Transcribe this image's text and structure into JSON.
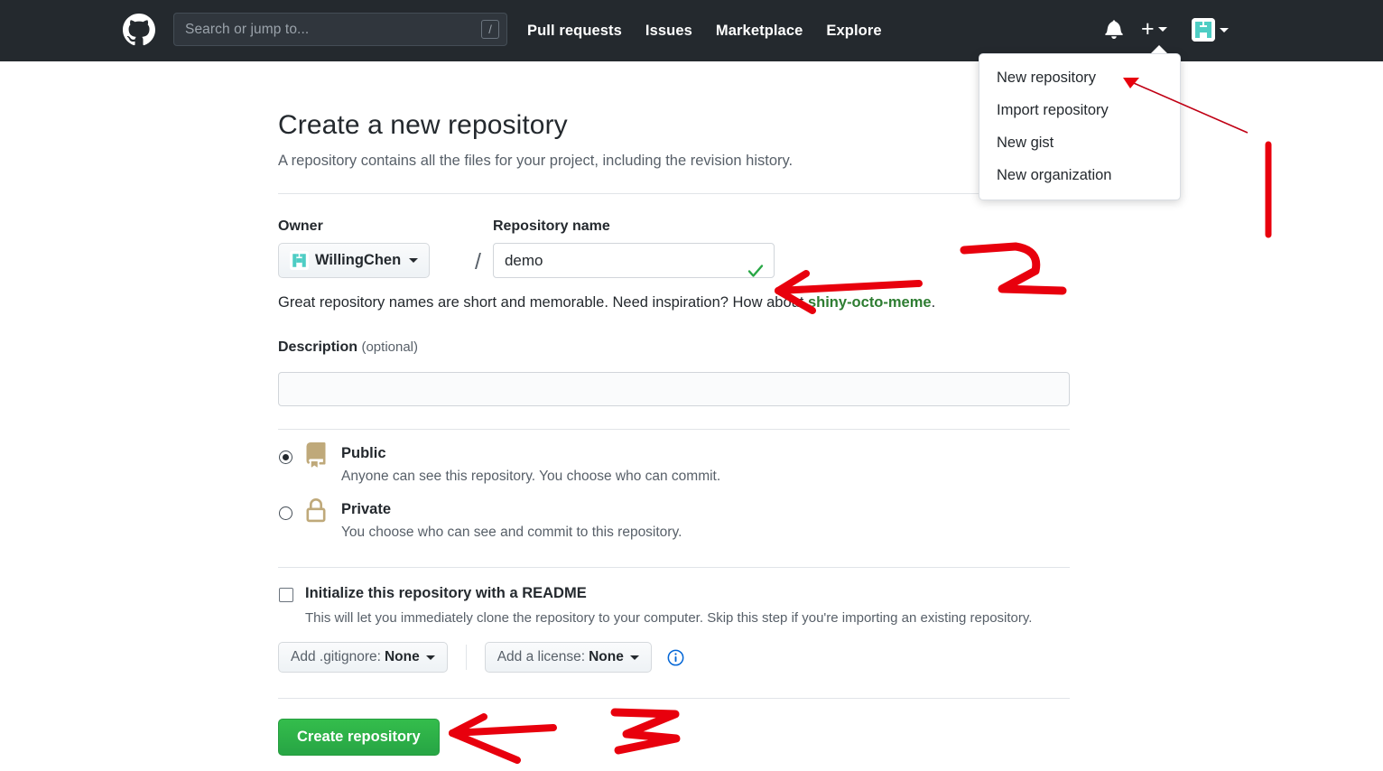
{
  "header": {
    "logo_icon": "github-mark-icon",
    "search": {
      "placeholder": "Search or jump to...",
      "value": "",
      "shortcut_key": "/"
    },
    "nav": [
      {
        "label": "Pull requests"
      },
      {
        "label": "Issues"
      },
      {
        "label": "Marketplace"
      },
      {
        "label": "Explore"
      }
    ],
    "notifications_icon": "bell-icon",
    "create_new_icon": "plus-icon",
    "account_icon": "avatar-icon",
    "background_color": "#24292e"
  },
  "create_menu": {
    "items": [
      {
        "label": "New repository"
      },
      {
        "label": "Import repository"
      },
      {
        "label": "New gist"
      },
      {
        "label": "New organization"
      }
    ]
  },
  "main": {
    "title": "Create a new repository",
    "subtitle": "A repository contains all the files for your project, including the revision history.",
    "owner": {
      "label": "Owner",
      "value": "WillingChen",
      "separator": "/"
    },
    "repository_name": {
      "label": "Repository name",
      "value": "demo",
      "placeholder": "",
      "valid_icon": "check-icon",
      "valid_color": "#28a745"
    },
    "name_hint": {
      "before": "Great repository names are short and memorable. Need inspiration? How about ",
      "link": "shiny-octo-meme",
      "after": ".",
      "link_color": "#2e7d32"
    },
    "description": {
      "label": "Description",
      "optional_label": "(optional)",
      "value": "",
      "placeholder": ""
    },
    "visibility": [
      {
        "id": "public",
        "icon": "repo-book-icon",
        "title": "Public",
        "description": "Anyone can see this repository. You choose who can commit.",
        "selected": true
      },
      {
        "id": "private",
        "icon": "lock-icon",
        "title": "Private",
        "description": "You choose who can see and commit to this repository.",
        "selected": false
      }
    ],
    "readme": {
      "title": "Initialize this repository with a README",
      "description": "This will let you immediately clone the repository to your computer. Skip this step if you're importing an existing repository.",
      "checked": false
    },
    "gitignore": {
      "prefix": "Add .gitignore:",
      "value": "None"
    },
    "license": {
      "prefix": "Add a license:",
      "value": "None"
    },
    "info_icon": "info-icon",
    "submit": {
      "label": "Create repository",
      "color": "#28a745"
    }
  },
  "annotations": {
    "color": "#e8000d",
    "marks": [
      {
        "name": "pointer-arrow-to-new-repository",
        "type": "thin-arrow"
      },
      {
        "name": "step-number-1",
        "type": "stroke",
        "text": "1"
      },
      {
        "name": "step-number-2",
        "type": "stroke",
        "text": "2"
      },
      {
        "name": "arrow-to-repository-name",
        "type": "thick-arrow"
      },
      {
        "name": "step-number-3",
        "type": "stroke",
        "text": "3"
      },
      {
        "name": "arrow-to-create-button",
        "type": "thick-arrow"
      }
    ]
  }
}
